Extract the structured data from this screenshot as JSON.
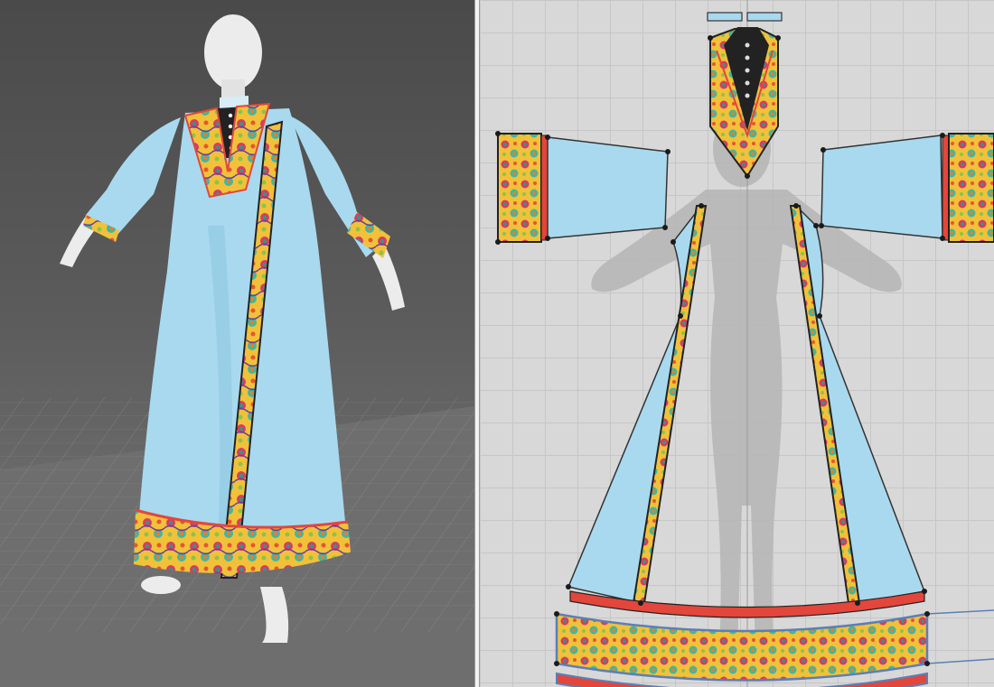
{
  "app": {
    "description_free": true
  },
  "views": {
    "left": {
      "name": "3d-viewport"
    },
    "right": {
      "name": "2d-pattern-window"
    }
  },
  "colors": {
    "fabric": "#a9d9ef",
    "trim_red": "#e3463b",
    "trim_black": "#222222",
    "avatar": "#eeeeee",
    "floor_grid": "#9c9c9c"
  },
  "icons": {
    "pattern_point": "pattern-point-icon"
  }
}
